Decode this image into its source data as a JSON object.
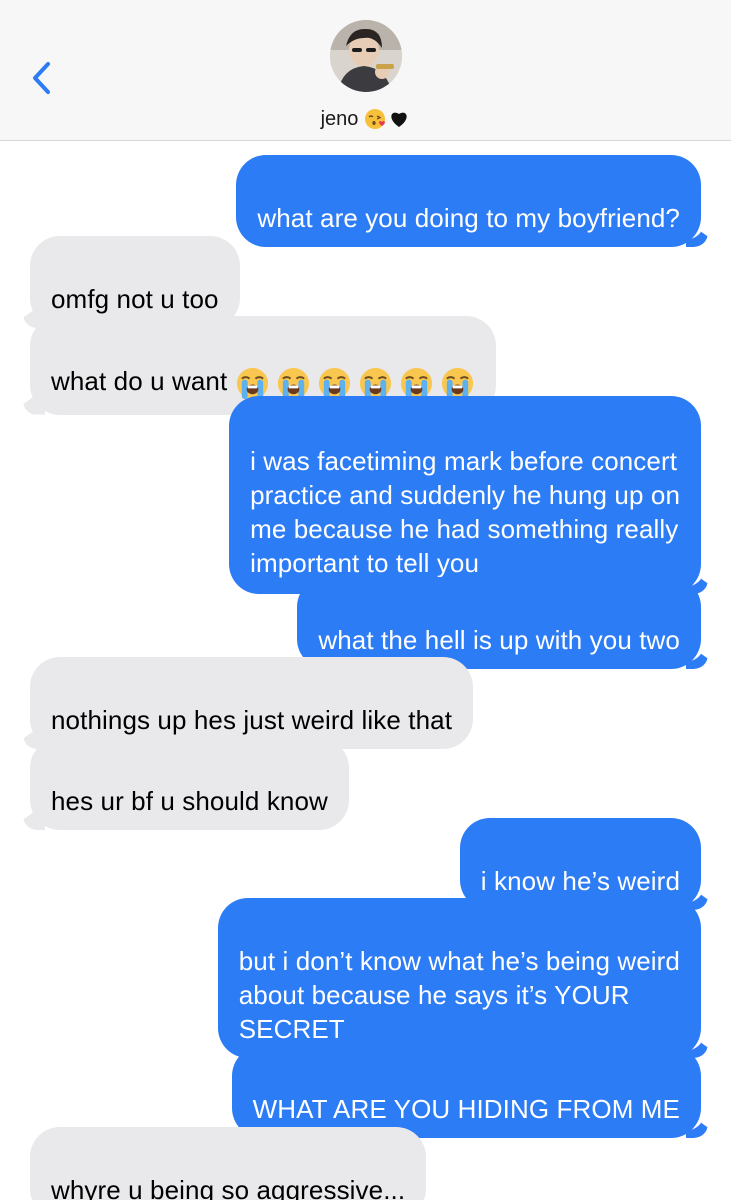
{
  "header": {
    "contact_name": "jeno",
    "name_emojis": [
      "face-blowing-kiss-icon",
      "black-heart-icon"
    ]
  },
  "messages": [
    {
      "from": "me",
      "text": "what are you doing to my boyfriend?"
    },
    {
      "from": "them",
      "text": "omfg not u too"
    },
    {
      "from": "them",
      "text": "what do u want",
      "emoji": "loudly-crying-face-icon",
      "emoji_count": 6
    },
    {
      "from": "me",
      "text": "i was facetiming mark before concert\npractice and suddenly he hung up on\nme because he had something really\nimportant to tell you"
    },
    {
      "from": "me",
      "text": "what the hell is up with you two"
    },
    {
      "from": "them",
      "text": "nothings up hes just weird like that"
    },
    {
      "from": "them",
      "text": "hes ur bf u should know"
    },
    {
      "from": "me",
      "text": "i know he’s weird"
    },
    {
      "from": "me",
      "text": "but i don’t know what he’s being weird\nabout because he says it’s YOUR\nSECRET"
    },
    {
      "from": "me",
      "text": "WHAT ARE YOU HIDING FROM ME"
    },
    {
      "from": "them",
      "text": "whyre u being so aggressive..."
    }
  ],
  "colors": {
    "sent_bubble": "#2c7cf6",
    "received_bubble": "#e9e9eb",
    "header_bg": "#f7f7f7",
    "back_chevron": "#2c7cf6"
  }
}
